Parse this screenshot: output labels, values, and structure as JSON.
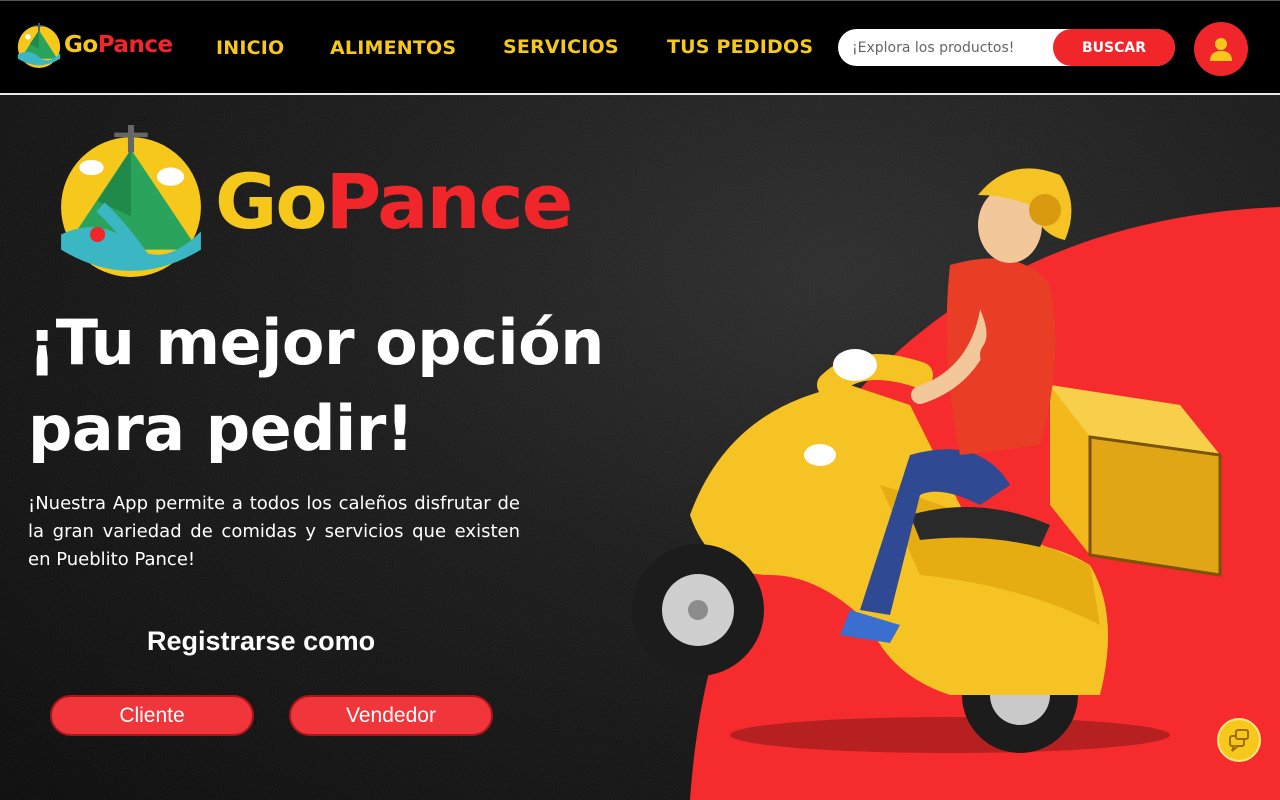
{
  "brand": {
    "go": "Go",
    "pance": "Pance"
  },
  "nav": {
    "items": [
      {
        "label": "INICIO"
      },
      {
        "label": "ALIMENTOS"
      },
      {
        "label": "SERVICIOS"
      },
      {
        "label": "TUS PEDIDOS"
      }
    ]
  },
  "search": {
    "placeholder": "¡Explora los productos!",
    "button_label": "BUSCAR"
  },
  "hero": {
    "headline_line1": "¡Tu mejor opción",
    "headline_line2": "para pedir!",
    "description": "¡Nuestra App permite a todos los caleños disfrutar de la gran variedad de comidas y servicios que existen en Pueblito Pance!",
    "register_label": "Registrarse como",
    "client_button": "Cliente",
    "seller_button": "Vendedor"
  },
  "icons": {
    "user": "user-icon",
    "chat": "chat-icon",
    "logo": "gopance-logo-icon",
    "illustration": "delivery-scooter-icon"
  },
  "colors": {
    "accent_yellow": "#f6c81c",
    "accent_red": "#f0262a",
    "background": "#000000"
  }
}
